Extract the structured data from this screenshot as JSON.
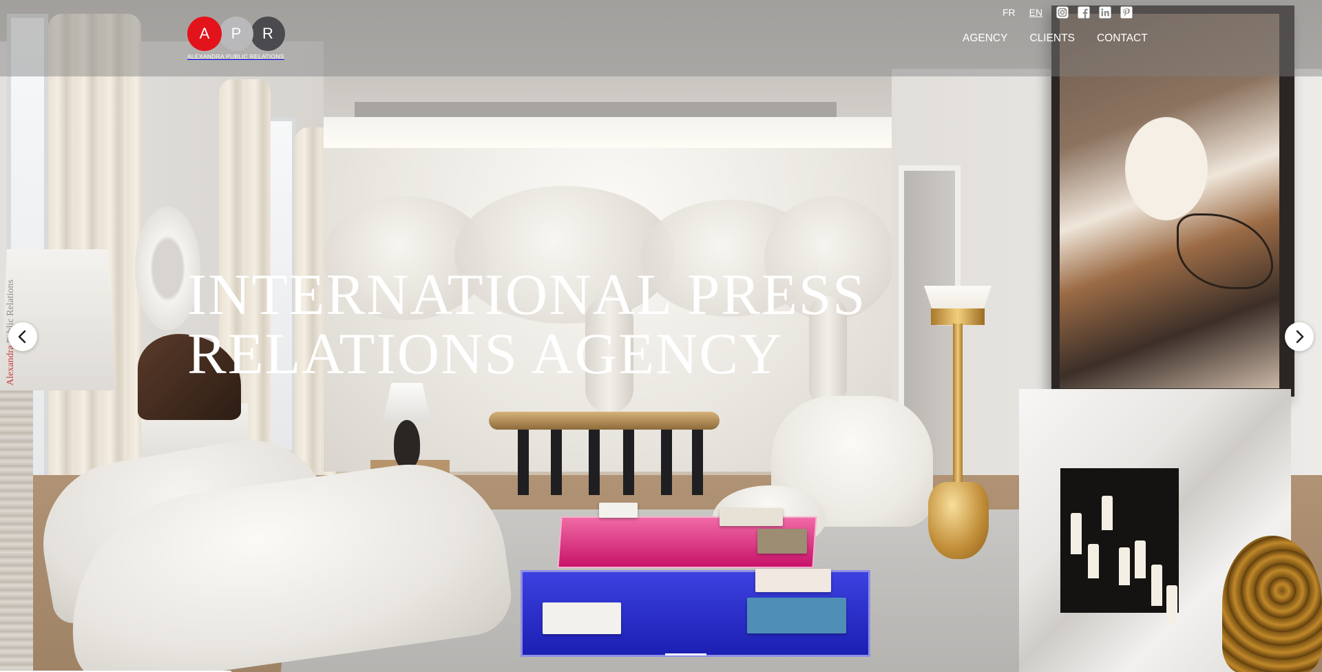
{
  "brand": {
    "letters": [
      "A",
      "P",
      "R"
    ],
    "name": "ALEXANDRA PUBLIC RELATIONS",
    "colors": {
      "a": "#e3131b",
      "p": "#b9b9bb",
      "r": "#4a4a4f"
    }
  },
  "languages": {
    "fr": "FR",
    "en": "EN",
    "active": "EN"
  },
  "social": [
    "instagram-icon",
    "facebook-icon",
    "linkedin-icon",
    "pinterest-icon"
  ],
  "nav": {
    "agency": "AGENCY",
    "clients": "CLIENTS",
    "contact": "CONTACT"
  },
  "hero": {
    "line1": "INTERNATIONAL PRESS",
    "line2": "RELATIONS AGENCY",
    "image": "living-room-interior"
  },
  "side_label": {
    "part1": "Alexandra",
    "part2": "Public Relations"
  },
  "carousel": {
    "prev_icon": "chevron-left-icon",
    "next_icon": "chevron-right-icon"
  }
}
